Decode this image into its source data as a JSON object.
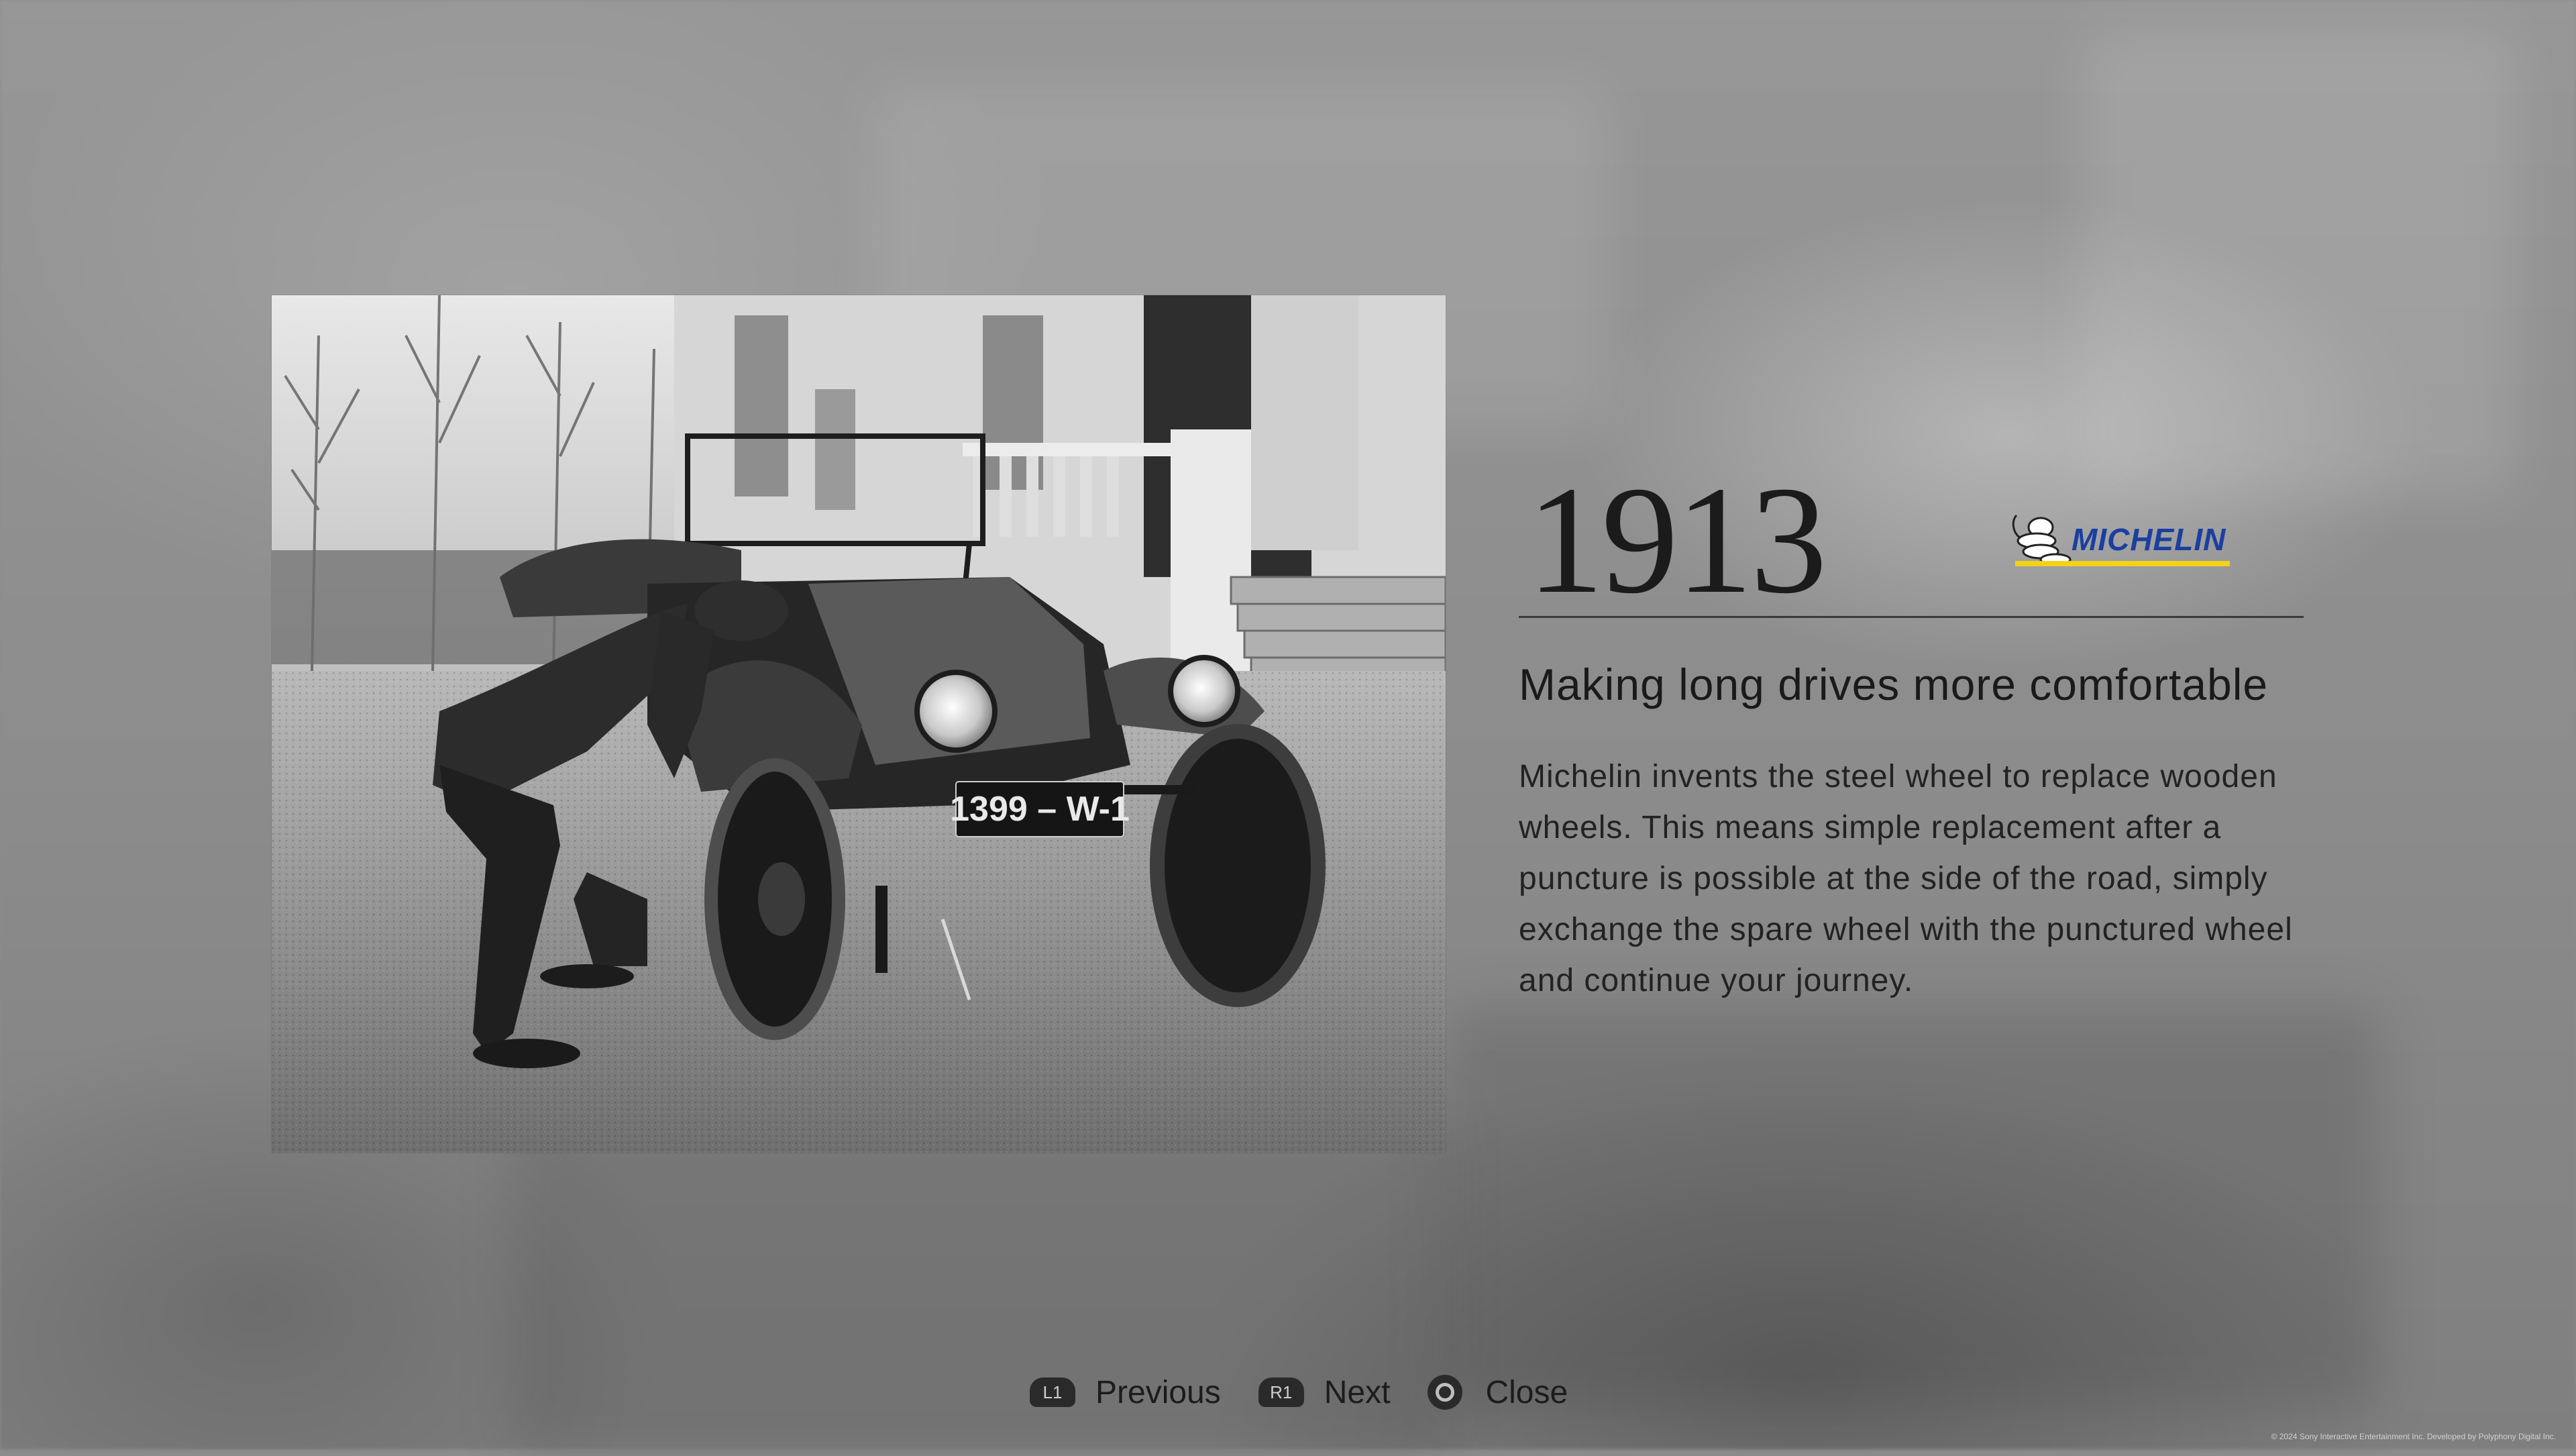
{
  "history": {
    "year": "1913",
    "brand_name": "MICHELIN",
    "headline": "Making long drives more comfortable",
    "body": "Michelin invents the steel wheel to replace wooden wheels. This means simple replacement after a puncture is possible at the side of the road, simply exchange the spare wheel with the punctured wheel and continue your journey.",
    "photo": {
      "plate_text": "1399 – W-1"
    }
  },
  "controls": {
    "previous": {
      "badge": "L1",
      "label": "Previous"
    },
    "next": {
      "badge": "R1",
      "label": "Next"
    },
    "close": {
      "label": "Close"
    }
  },
  "footer": {
    "copyright": "© 2024 Sony Interactive Entertainment Inc. Developed by Polyphony Digital Inc."
  },
  "colors": {
    "brand_blue": "#1b3fa0",
    "brand_yellow": "#f2d21a",
    "text_dark": "#1f1f1f",
    "badge_dark": "#2a2a2a"
  },
  "icons": {
    "l1_badge": "l1-button-icon",
    "r1_badge": "r1-button-icon",
    "close": "circle-button-icon"
  }
}
